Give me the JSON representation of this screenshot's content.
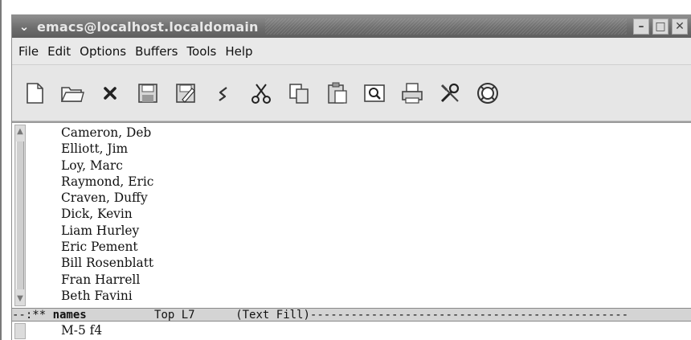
{
  "window": {
    "title": "emacs@localhost.localdomain",
    "controls": [
      "minimize-icon",
      "maximize-icon",
      "close-icon"
    ]
  },
  "menu": [
    "File",
    "Edit",
    "Options",
    "Buffers",
    "Tools",
    "Help"
  ],
  "toolbar": [
    {
      "name": "new-file-icon"
    },
    {
      "name": "open-folder-icon"
    },
    {
      "name": "close-buffer-icon"
    },
    {
      "name": "save-icon"
    },
    {
      "name": "save-as-icon"
    },
    {
      "name": "undo-icon"
    },
    {
      "name": "cut-icon"
    },
    {
      "name": "copy-icon"
    },
    {
      "name": "paste-icon"
    },
    {
      "name": "search-icon"
    },
    {
      "name": "print-icon"
    },
    {
      "name": "preferences-icon"
    },
    {
      "name": "help-icon"
    }
  ],
  "buffer": {
    "lines": [
      "Cameron, Deb",
      "Elliott, Jim",
      "Loy, Marc",
      "Raymond, Eric",
      "Craven, Duffy",
      "Dick, Kevin",
      "Liam Hurley",
      "Eric Pement",
      "Bill Rosenblatt",
      "Fran Harrell",
      "Beth Favini"
    ]
  },
  "modeline": {
    "prefix": "--:** ",
    "buffer_name": "names",
    "position": "Top L7",
    "mode": "(Text Fill)",
    "trail": "-----------------------------------------------"
  },
  "minibuffer": {
    "text": "M-5 f4"
  },
  "colors": {
    "titlebar": "#6e6e6e",
    "chrome": "#e6e6e6",
    "buffer_bg": "#ffffff",
    "modeline_bg": "#d4d4d4"
  }
}
